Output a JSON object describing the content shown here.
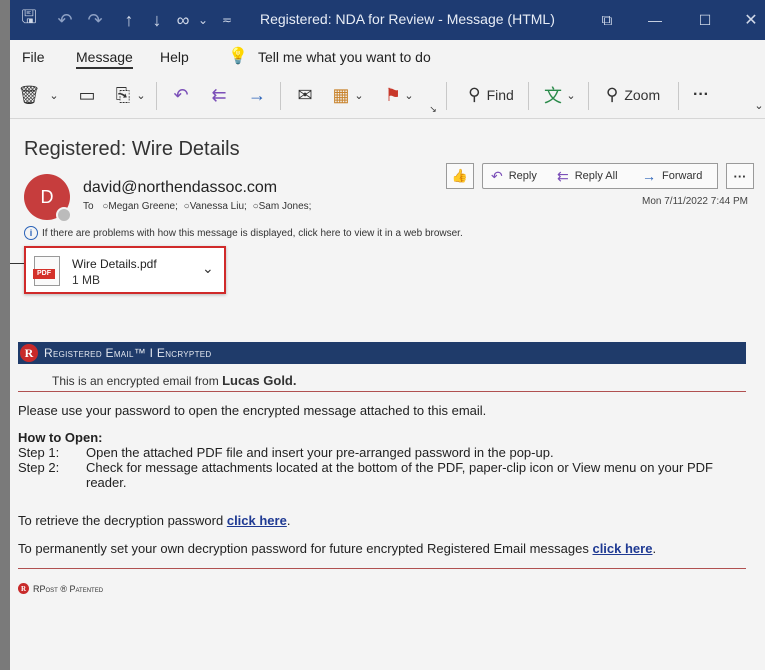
{
  "window": {
    "title": "Registered: NDA for Review  -  Message (HTML)",
    "title_icons": [
      "save-icon",
      "undo-icon",
      "redo-icon",
      "up-arrow-icon",
      "down-arrow-icon",
      "link-icon",
      "dropdown-icon",
      "customize-icon"
    ],
    "controls": [
      "ribbon-display-icon",
      "minimize-icon",
      "maximize-icon",
      "close-icon"
    ]
  },
  "menu": {
    "file": "File",
    "message": "Message",
    "help": "Help",
    "tell_me": "Tell me what you want to do"
  },
  "ribbon": {
    "find": "Find",
    "zoom": "Zoom",
    "more": "···"
  },
  "message": {
    "subject": "Registered: Wire Details",
    "avatar_initial": "D",
    "from": "david@northendassoc.com",
    "to_label": "To",
    "recipients": [
      "Megan Greene;",
      "Vanessa Liu;",
      "Sam Jones;"
    ],
    "actions": {
      "reply": "Reply",
      "reply_all": "Reply All",
      "forward": "Forward",
      "more": "···"
    },
    "date": "Mon 7/11/2022 7:44 PM",
    "info_bar": "If there are problems with how this message is displayed, click here to view it in a web browser.",
    "attachment": {
      "name": "Wire Details.pdf",
      "size": "1 MB",
      "badge": "PDF"
    }
  },
  "email_body": {
    "banner_logo": "R",
    "banner_text": "Registered Email™ I Encrypted",
    "encrypted_prefix": "This is an encrypted email from",
    "sender_name": "Lucas Gold.",
    "intro": "Please use your password to open the encrypted message attached to this email.",
    "how_to": "How to Open:",
    "step1_label": "Step 1:",
    "step1_text": "Open the attached PDF file and insert your pre-arranged password in the pop-up.",
    "step2_label": "Step 2:",
    "step2_text": "Check for message attachments located at the bottom of the PDF, paper-clip icon or View menu on your PDF reader.",
    "retrieve_text": "To retrieve the decryption password",
    "retrieve_link": "click here",
    "permanent_text": "To permanently set your own decryption password for future encrypted Registered Email messages",
    "permanent_link": "click here",
    "footer": "RPost ® Patented",
    "footer_logo": "R"
  },
  "colors": {
    "titlebar": "#1e3b72",
    "banner": "#1f3b6a",
    "accent_red": "#c82a2a",
    "avatar": "#c63d3d",
    "link": "#1f3a93"
  }
}
